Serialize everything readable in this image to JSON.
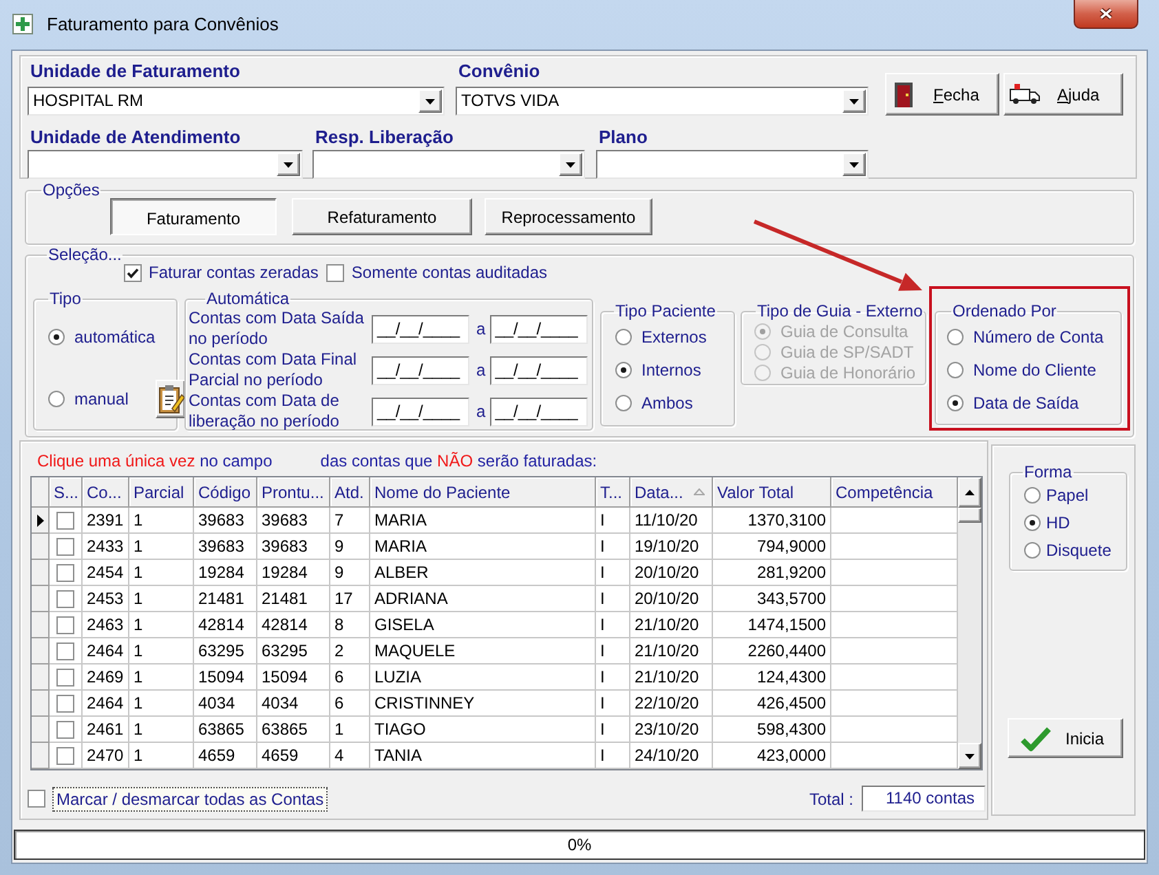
{
  "window": {
    "title": "Faturamento para Convênios"
  },
  "header": {
    "fields_top": [
      {
        "label": "Unidade de Faturamento",
        "value": "HOSPITAL RM"
      },
      {
        "label": "Convênio",
        "value": "TOTVS VIDA"
      }
    ],
    "buttons": [
      {
        "kind": "close",
        "label_parts": [
          {
            "text": "F",
            "underlined": true
          },
          {
            "text": "echa",
            "underlined": false
          }
        ]
      },
      {
        "kind": "help",
        "label_parts": [
          {
            "text": "A",
            "underlined": true
          },
          {
            "text": "juda",
            "underlined": false
          }
        ]
      }
    ],
    "fields_bottom": [
      {
        "label": "Unidade de Atendimento"
      },
      {
        "label": "Resp. Liberação"
      },
      {
        "label": "Plano"
      }
    ]
  },
  "opcoes": {
    "title": "Opções",
    "buttons": [
      {
        "label": "Faturamento",
        "selected": true
      },
      {
        "label": "Refaturamento",
        "selected": false
      },
      {
        "label": "Reprocessamento",
        "selected": false
      }
    ]
  },
  "selecao": {
    "title": "Seleção...",
    "checkboxes": [
      {
        "label": "Faturar contas zeradas",
        "checked": true
      },
      {
        "label": "Somente contas auditadas",
        "checked": false
      }
    ],
    "tipo": {
      "title": "Tipo",
      "options": [
        {
          "label": "automática",
          "selected": true
        },
        {
          "label": "manual",
          "selected": false
        }
      ]
    },
    "automatica": {
      "title": "Automática",
      "rows": [
        {
          "label": "Contas com Data Saída no período",
          "from": "__/__/____",
          "separator": "a",
          "to": "__/__/____"
        },
        {
          "label": "Contas com Data Final Parcial no período",
          "from": "__/__/____",
          "separator": "a",
          "to": "__/__/____"
        },
        {
          "label": "Contas com Data de liberação no período",
          "from": "__/__/____",
          "separator": "a",
          "to": "__/__/____"
        }
      ]
    },
    "tipo_paciente": {
      "title": "Tipo Paciente",
      "options": [
        {
          "label": "Externos",
          "selected": false
        },
        {
          "label": "Internos",
          "selected": true
        },
        {
          "label": "Ambos",
          "selected": false
        }
      ]
    },
    "tipo_guia": {
      "title": "Tipo de Guia - Externo",
      "disabled": true,
      "options": [
        {
          "label": "Guia de Consulta",
          "selected": true
        },
        {
          "label": "Guia de SP/SADT",
          "selected": false
        },
        {
          "label": "Guia de Honorário",
          "selected": false
        }
      ]
    },
    "ordenado_por": {
      "title": "Ordenado Por",
      "highlighted": true,
      "options": [
        {
          "label": "Número de Conta",
          "selected": false
        },
        {
          "label": "Nome do Cliente",
          "selected": false
        },
        {
          "label": "Data de Saída",
          "selected": true
        }
      ]
    }
  },
  "contas": {
    "instruction": [
      [
        {
          "text": "Clique uma única vez",
          "emphasis": true
        },
        {
          "text": "no campo",
          "emphasis": false
        }
      ],
      [
        {
          "text": "das contas que",
          "emphasis": false
        },
        {
          "text": "NÃO",
          "emphasis": true
        },
        {
          "text": "serão faturadas:",
          "emphasis": false
        }
      ]
    ],
    "table": {
      "columns": [
        {
          "label": "S...",
          "sorted": false
        },
        {
          "label": "Co...",
          "sorted": false
        },
        {
          "label": "Parcial",
          "sorted": false
        },
        {
          "label": "Código",
          "sorted": false
        },
        {
          "label": "Prontu...",
          "sorted": false
        },
        {
          "label": "Atd.",
          "sorted": false
        },
        {
          "label": "Nome do Paciente",
          "sorted": false
        },
        {
          "label": "T...",
          "sorted": false
        },
        {
          "label": "Data...",
          "sorted": true
        },
        {
          "label": "Valor Total",
          "sorted": false
        },
        {
          "label": "Competência",
          "sorted": false
        }
      ],
      "rows": [
        {
          "current": true,
          "checked": false,
          "cells": [
            "",
            "2391",
            "1",
            "39683",
            "39683",
            "7",
            "MARIA",
            "I",
            "11/10/20",
            "1370,3100",
            ""
          ]
        },
        {
          "current": false,
          "checked": false,
          "cells": [
            "",
            "2433",
            "1",
            "39683",
            "39683",
            "9",
            "MARIA",
            "I",
            "19/10/20",
            "794,9000",
            ""
          ]
        },
        {
          "current": false,
          "checked": false,
          "cells": [
            "",
            "2454",
            "1",
            "19284",
            "19284",
            "9",
            "ALBER",
            "I",
            "20/10/20",
            "281,9200",
            ""
          ]
        },
        {
          "current": false,
          "checked": false,
          "cells": [
            "",
            "2453",
            "1",
            "21481",
            "21481",
            "17",
            "ADRIANA",
            "I",
            "20/10/20",
            "343,5700",
            ""
          ]
        },
        {
          "current": false,
          "checked": false,
          "cells": [
            "",
            "2463",
            "1",
            "42814",
            "42814",
            "8",
            "GISELA",
            "I",
            "21/10/20",
            "1474,1500",
            ""
          ]
        },
        {
          "current": false,
          "checked": false,
          "cells": [
            "",
            "2464",
            "1",
            "63295",
            "63295",
            "2",
            "MAQUELE",
            "I",
            "21/10/20",
            "2260,4400",
            ""
          ]
        },
        {
          "current": false,
          "checked": false,
          "cells": [
            "",
            "2469",
            "1",
            "15094",
            "15094",
            "6",
            "LUZIA",
            "I",
            "21/10/20",
            "124,4300",
            ""
          ]
        },
        {
          "current": false,
          "checked": false,
          "cells": [
            "",
            "2464",
            "1",
            "4034",
            "4034",
            "6",
            "CRISTINNEY",
            "I",
            "22/10/20",
            "426,4500",
            ""
          ]
        },
        {
          "current": false,
          "checked": false,
          "cells": [
            "",
            "2461",
            "1",
            "63865",
            "63865",
            "1",
            "TIAGO",
            "I",
            "23/10/20",
            "598,4300",
            ""
          ]
        },
        {
          "current": false,
          "checked": false,
          "cells": [
            "",
            "2470",
            "1",
            "4659",
            "4659",
            "4",
            "TANIA",
            "I",
            "24/10/20",
            "423,0000",
            ""
          ]
        }
      ]
    },
    "select_all": {
      "label": "Marcar / desmarcar todas as Contas",
      "checked": false,
      "focused": true
    },
    "total": {
      "label": "Total :",
      "value": "1140 contas"
    }
  },
  "forma": {
    "title": "Forma",
    "options": [
      {
        "label": "Papel",
        "selected": false
      },
      {
        "label": "HD",
        "selected": true
      },
      {
        "label": "Disquete",
        "selected": false
      }
    ]
  },
  "start_button": {
    "label": "Inicia"
  },
  "progress": {
    "text": "0%",
    "level": 0
  }
}
